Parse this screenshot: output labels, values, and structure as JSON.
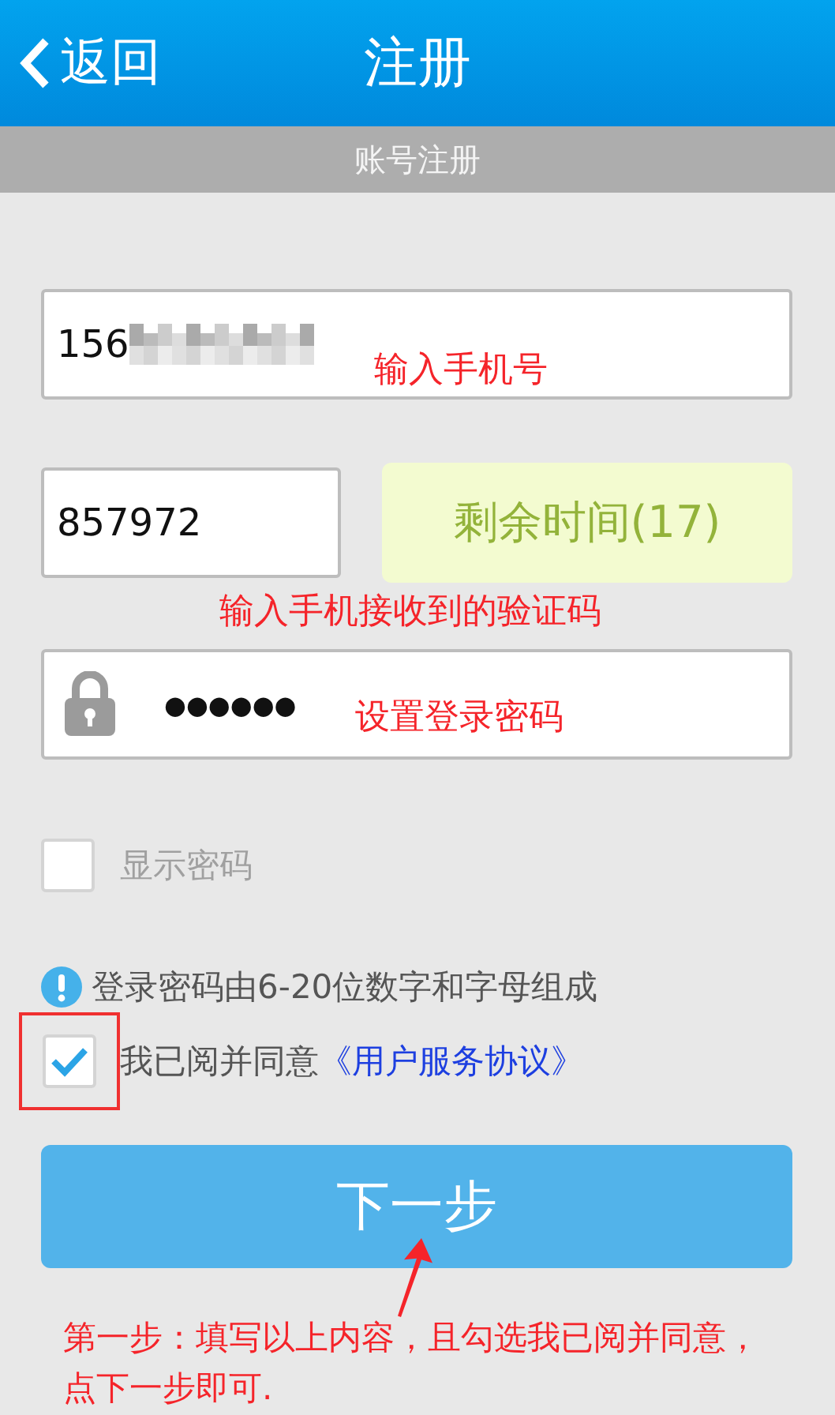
{
  "header": {
    "back": "返回",
    "title": "注册"
  },
  "subheader": "账号注册",
  "phone": {
    "value": "156",
    "masked": true
  },
  "code": {
    "value": "857972"
  },
  "timer": "剩余时间(17)",
  "password": {
    "value": "●●●●●●"
  },
  "show_password": {
    "label": "显示密码",
    "checked": false
  },
  "hint": "登录密码由6-20位数字和字母组成",
  "agree": {
    "text": "我已阅并同意",
    "link": "《用户服务协议》",
    "checked": true,
    "highlighted": true
  },
  "next": "下一步",
  "annotations": {
    "phone": "输入手机号",
    "code": "输入手机接收到的验证码",
    "password": "设置登录密码",
    "footer": "第一步：填写以上内容，且勾选我已阅并同意，点下一步即可."
  }
}
